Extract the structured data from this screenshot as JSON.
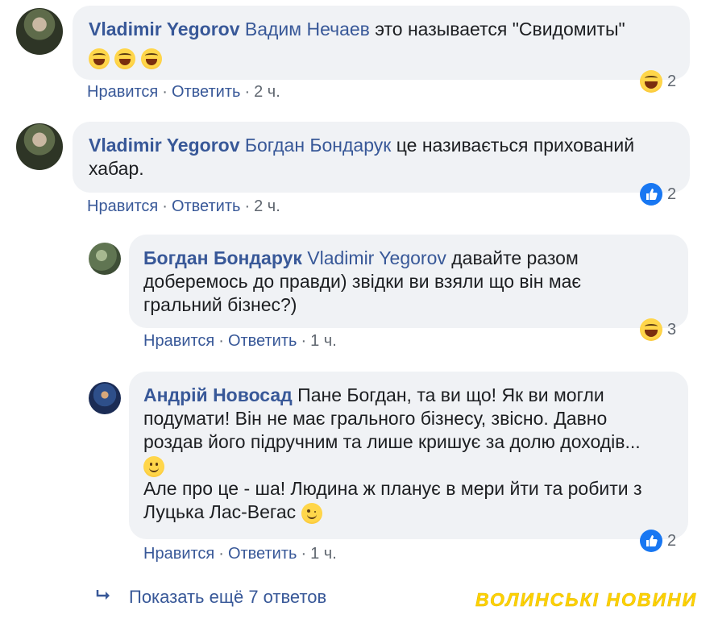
{
  "comments": [
    {
      "author": "Vladimir Yegorov",
      "mention": "Вадим Нечаев",
      "text_lines": [
        "это называется \"Свидомиты\""
      ],
      "emoji": [
        "laughing-tears",
        "laughing-tears",
        "laughing-tears"
      ],
      "actions": {
        "like": "Нравится",
        "reply": "Ответить",
        "time": "2 ч."
      },
      "reaction": {
        "icon": "haha-icon",
        "count": "2"
      }
    },
    {
      "author": "Vladimir Yegorov",
      "mention": "Богдан Бондарук",
      "text_lines": [
        "це називається прихований",
        "хабар."
      ],
      "actions": {
        "like": "Нравится",
        "reply": "Ответить",
        "time": "2 ч."
      },
      "reaction": {
        "icon": "like-icon",
        "count": "2"
      }
    },
    {
      "author": "Богдан Бондарук",
      "mention": "Vladimir Yegorov",
      "text_lines": [
        "давайте разом",
        "доберемось до правди) звідки ви взяли що він має",
        "гральний бізнес?)"
      ],
      "actions": {
        "like": "Нравится",
        "reply": "Ответить",
        "time": "1 ч."
      },
      "reaction": {
        "icon": "haha-icon",
        "count": "3"
      }
    },
    {
      "author": "Андрій Новосад",
      "mention": "",
      "text_lines": [
        "Пане Богдан, та ви що! Як ви могли",
        "подумати! Він не має грального бізнесу, звісно. Давно",
        "роздав його підручним та лише кришує за долю доходів...",
        "Але про це - ша! Людина ж планує в мери йти та робити з",
        "Луцька Лас-Вегас"
      ],
      "actions": {
        "like": "Нравится",
        "reply": "Ответить",
        "time": "1 ч."
      },
      "reaction": {
        "icon": "like-icon",
        "count": "2"
      }
    }
  ],
  "more_replies": "Показать ещё 7 ответов",
  "watermark": "ВОЛИНСЬКІ НОВИНИ",
  "colors": {
    "link": "#385898",
    "bubble": "#f0f2f5",
    "meta": "#606770",
    "like_blue": "#1877f2",
    "watermark": "#ffd200"
  }
}
